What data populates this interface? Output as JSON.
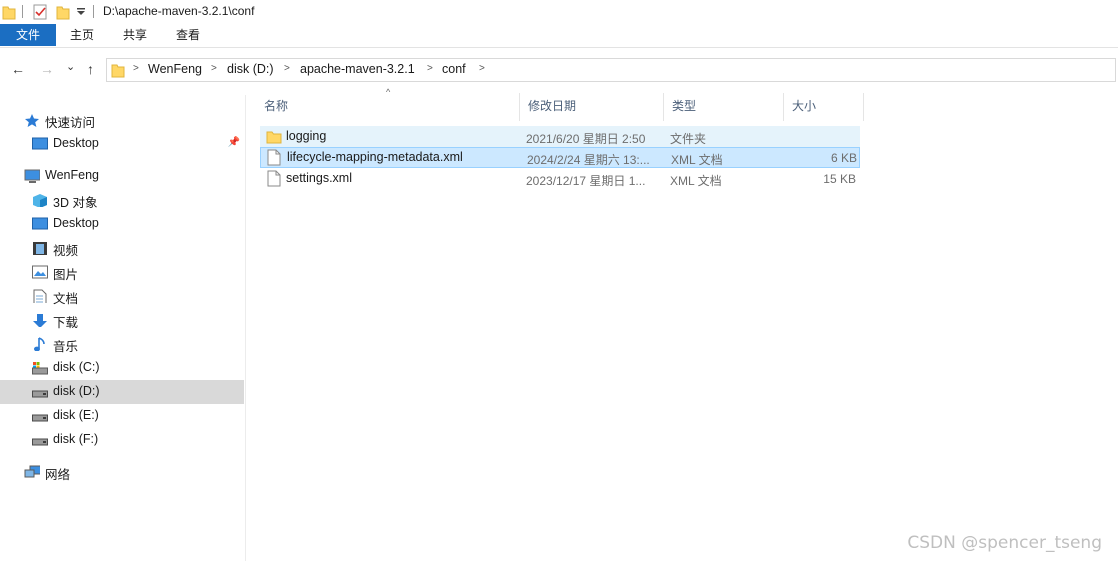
{
  "window": {
    "title_path": "D:\\apache-maven-3.2.1\\conf"
  },
  "ribbon": {
    "tabs": [
      "文件",
      "主页",
      "共享",
      "查看"
    ]
  },
  "nav": {
    "back": "←",
    "forward": "→",
    "recent": "⌄",
    "up": "↑"
  },
  "breadcrumb": [
    "WenFeng",
    "disk (D:)",
    "apache-maven-3.2.1",
    "conf"
  ],
  "sidebar": {
    "quick_access": "快速访问",
    "quick_items": [
      {
        "label": "Desktop",
        "icon": "desktop-icon",
        "pinned": true
      }
    ],
    "this_pc": "WenFeng",
    "pc_items": [
      {
        "label": "3D 对象",
        "icon": "3d-objects-icon"
      },
      {
        "label": "Desktop",
        "icon": "desktop-icon"
      },
      {
        "label": "视频",
        "icon": "video-icon"
      },
      {
        "label": "图片",
        "icon": "pictures-icon"
      },
      {
        "label": "文档",
        "icon": "documents-icon"
      },
      {
        "label": "下载",
        "icon": "downloads-icon"
      },
      {
        "label": "音乐",
        "icon": "music-icon"
      },
      {
        "label": "disk (C:)",
        "icon": "system-drive-icon"
      },
      {
        "label": "disk (D:)",
        "icon": "drive-icon",
        "selected": true
      },
      {
        "label": "disk (E:)",
        "icon": "drive-icon"
      },
      {
        "label": "disk (F:)",
        "icon": "drive-icon"
      }
    ],
    "network": "网络"
  },
  "files": {
    "columns": [
      "名称",
      "修改日期",
      "类型",
      "大小"
    ],
    "rows": [
      {
        "name": "logging",
        "date": "2021/6/20 星期日 2:50",
        "type": "文件夹",
        "size": "",
        "icon": "folder-icon",
        "state": "hover"
      },
      {
        "name": "lifecycle-mapping-metadata.xml",
        "date": "2024/2/24 星期六 13:...",
        "type": "XML 文档",
        "size": "6 KB",
        "icon": "xml-file-icon",
        "state": "selected"
      },
      {
        "name": "settings.xml",
        "date": "2023/12/17 星期日 1...",
        "type": "XML 文档",
        "size": "15 KB",
        "icon": "xml-file-icon",
        "state": ""
      }
    ]
  },
  "watermark": "CSDN @spencer_tseng",
  "colors": {
    "accent": "#1b6ec2",
    "selection": "#cce8ff",
    "hover": "#e5f3fb",
    "folder": "#ffd766"
  }
}
